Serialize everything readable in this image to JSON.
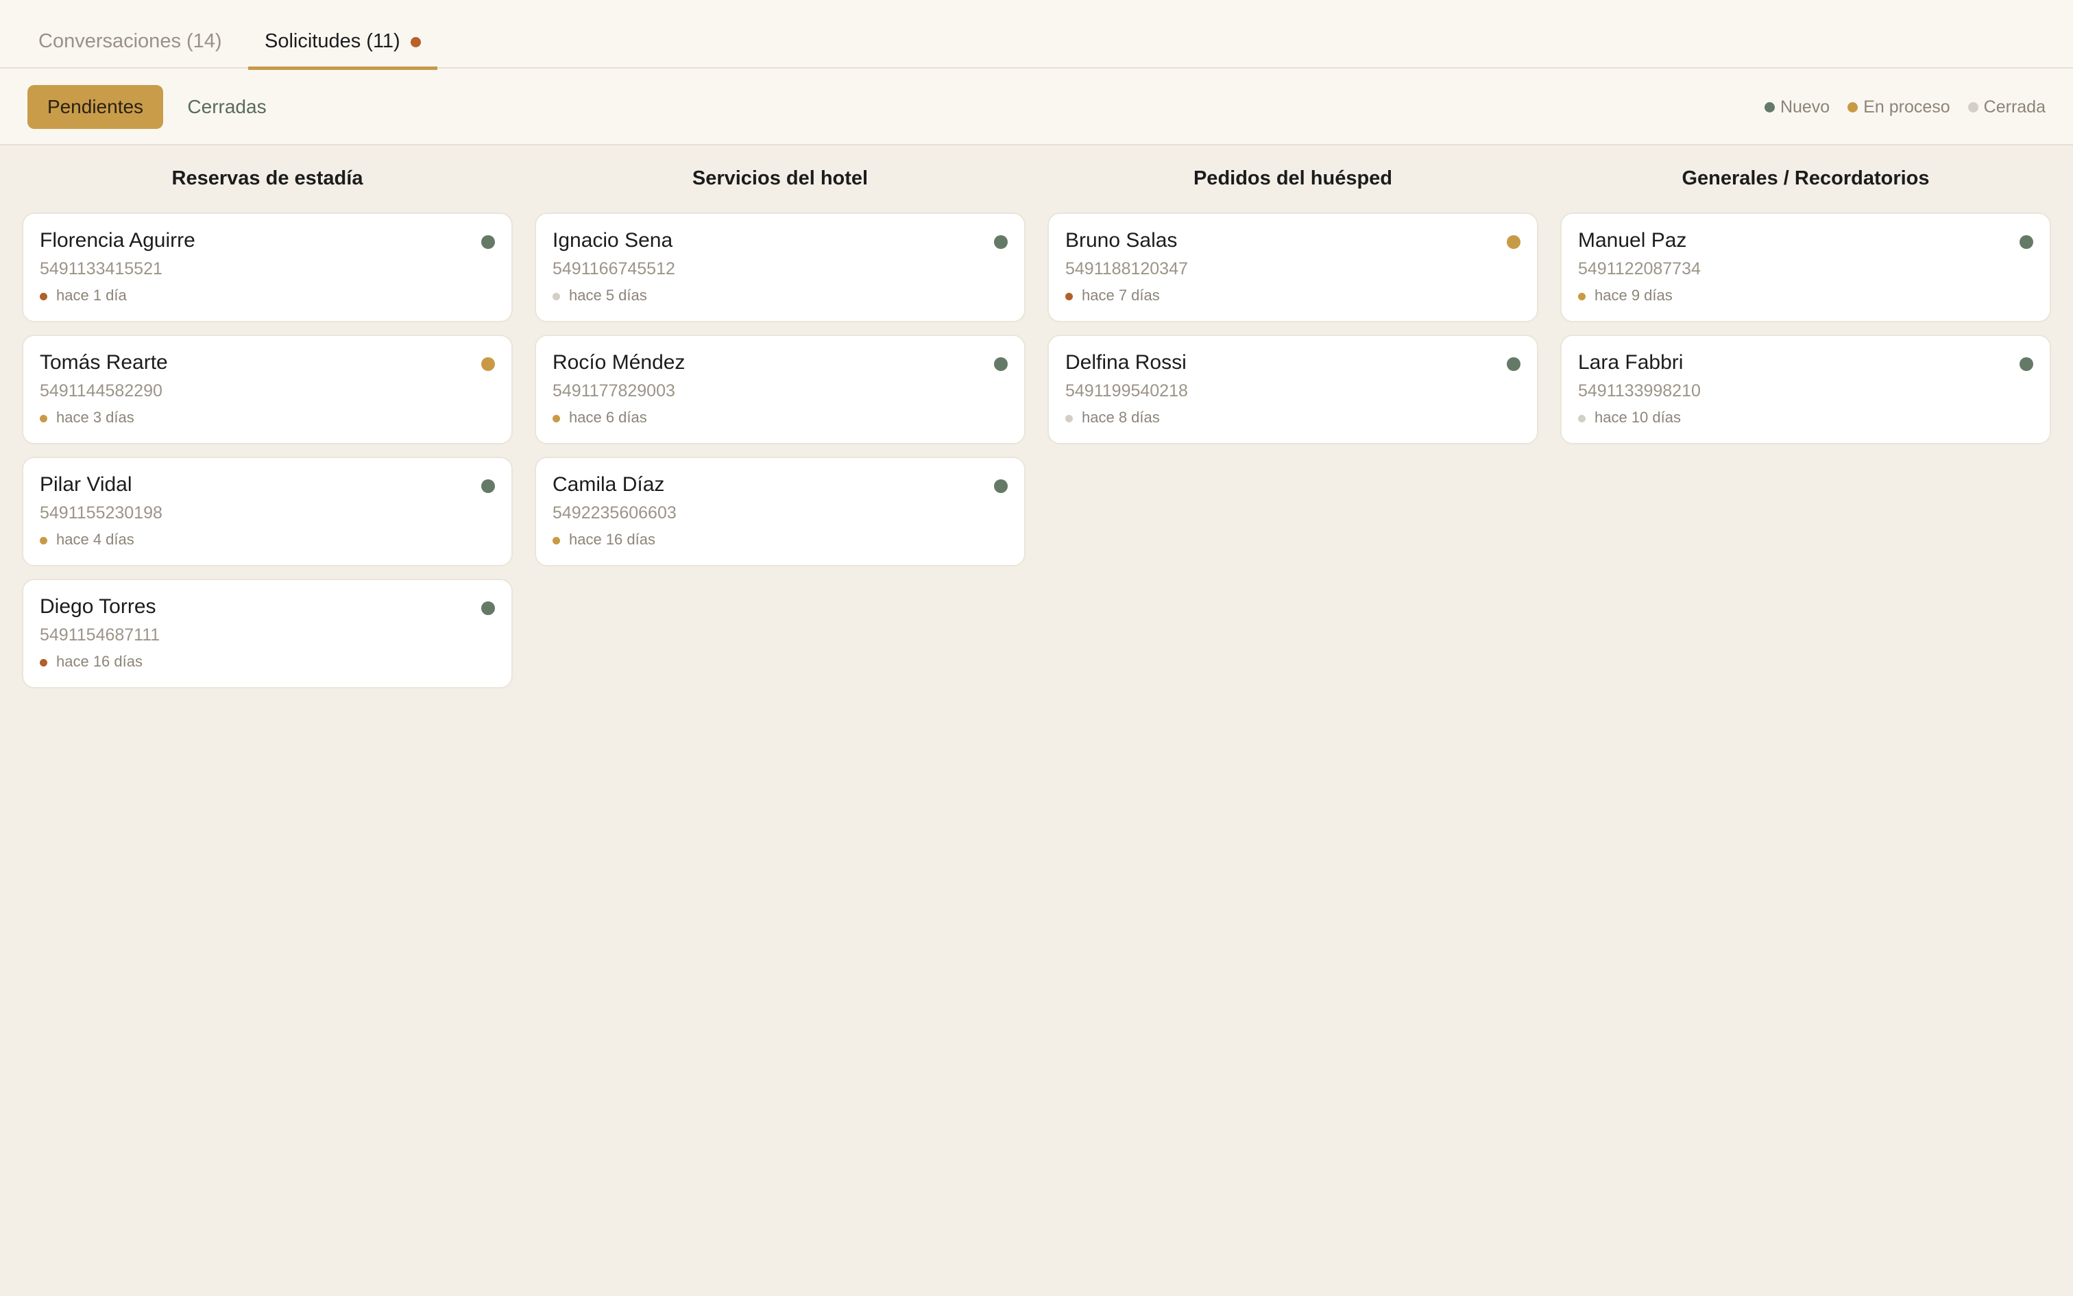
{
  "tabs": {
    "conversations_label": "Conversaciones (14)",
    "requests_label": "Solicitudes (11)"
  },
  "filters": {
    "pending_label": "Pendientes",
    "closed_label": "Cerradas"
  },
  "legend": [
    {
      "label": "Nuevo",
      "color": "#647a67"
    },
    {
      "label": "En proceso",
      "color": "#c99a45"
    },
    {
      "label": "Cerrada",
      "color": "#d3cfc6"
    }
  ],
  "colors": {
    "new": "#647a67",
    "in_progress": "#c99a45",
    "closed": "#d3cfc6",
    "urgent": "#b0602b"
  },
  "columns": [
    {
      "title": "Reservas de estadía",
      "cards": [
        {
          "name": "Florencia Aguirre",
          "phone": "5491133415521",
          "time": "hace 1 día",
          "status": "new",
          "time_dot": "urgent"
        },
        {
          "name": "Tomás Rearte",
          "phone": "5491144582290",
          "time": "hace 3 días",
          "status": "in_progress",
          "time_dot": "in_progress"
        },
        {
          "name": "Pilar Vidal",
          "phone": "5491155230198",
          "time": "hace 4 días",
          "status": "new",
          "time_dot": "in_progress"
        },
        {
          "name": "Diego Torres",
          "phone": "5491154687111",
          "time": "hace 16 días",
          "status": "new",
          "time_dot": "urgent"
        }
      ]
    },
    {
      "title": "Servicios del hotel",
      "cards": [
        {
          "name": "Ignacio Sena",
          "phone": "5491166745512",
          "time": "hace 5 días",
          "status": "new",
          "time_dot": "closed"
        },
        {
          "name": "Rocío Méndez",
          "phone": "5491177829003",
          "time": "hace 6 días",
          "status": "new",
          "time_dot": "in_progress"
        },
        {
          "name": "Camila Díaz",
          "phone": "5492235606603",
          "time": "hace 16 días",
          "status": "new",
          "time_dot": "in_progress"
        }
      ]
    },
    {
      "title": "Pedidos del huésped",
      "cards": [
        {
          "name": "Bruno Salas",
          "phone": "5491188120347",
          "time": "hace 7 días",
          "status": "in_progress",
          "time_dot": "urgent"
        },
        {
          "name": "Delfina Rossi",
          "phone": "5491199540218",
          "time": "hace 8 días",
          "status": "new",
          "time_dot": "closed"
        }
      ]
    },
    {
      "title": "Generales / Recordatorios",
      "cards": [
        {
          "name": "Manuel Paz",
          "phone": "5491122087734",
          "time": "hace 9 días",
          "status": "new",
          "time_dot": "in_progress"
        },
        {
          "name": "Lara Fabbri",
          "phone": "5491133998210",
          "time": "hace 10 días",
          "status": "new",
          "time_dot": "closed"
        }
      ]
    }
  ]
}
